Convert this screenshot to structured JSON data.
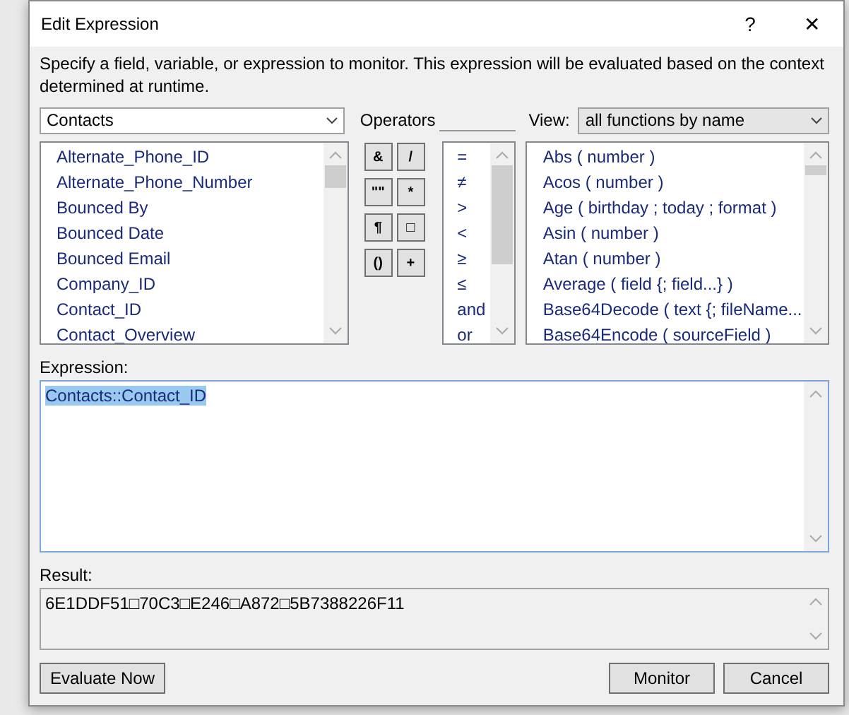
{
  "window": {
    "title": "Edit Expression",
    "help": "?",
    "close": "✕"
  },
  "description": "Specify a field, variable, or expression to monitor. This expression will be evaluated based on the context determined at runtime.",
  "table_select": {
    "value": "Contacts"
  },
  "operators_label": "Operators",
  "view": {
    "label": "View:",
    "value": "all functions by name"
  },
  "fields": [
    "Alternate_Phone_ID",
    "Alternate_Phone_Number",
    "Bounced By",
    "Bounced Date",
    "Bounced Email",
    "Company_ID",
    "Contact_ID",
    "Contact_Overview"
  ],
  "operator_buttons": [
    "&",
    "/",
    "\"\"",
    "*",
    "¶",
    "□",
    "()",
    "+"
  ],
  "operators": [
    "=",
    "≠",
    ">",
    "<",
    "≥",
    "≤",
    "and",
    "or"
  ],
  "functions": [
    "Abs ( number )",
    "Acos ( number )",
    "Age ( birthday ; today ; format )",
    "Asin ( number )",
    "Atan ( number )",
    "Average ( field {; field...} )",
    "Base64Decode ( text {; fileName...",
    "Base64Encode ( sourceField )"
  ],
  "expression": {
    "label": "Expression:",
    "value": "Contacts::Contact_ID",
    "text_selected": true
  },
  "result": {
    "label": "Result:",
    "value": "6E1DDF51□70C3□E246□A872□5B7388226F11"
  },
  "buttons": [
    {
      "label": "Evaluate Now",
      "kind": "left"
    },
    {
      "label": "Monitor",
      "kind": "right"
    },
    {
      "label": "Cancel",
      "kind": "right"
    }
  ]
}
